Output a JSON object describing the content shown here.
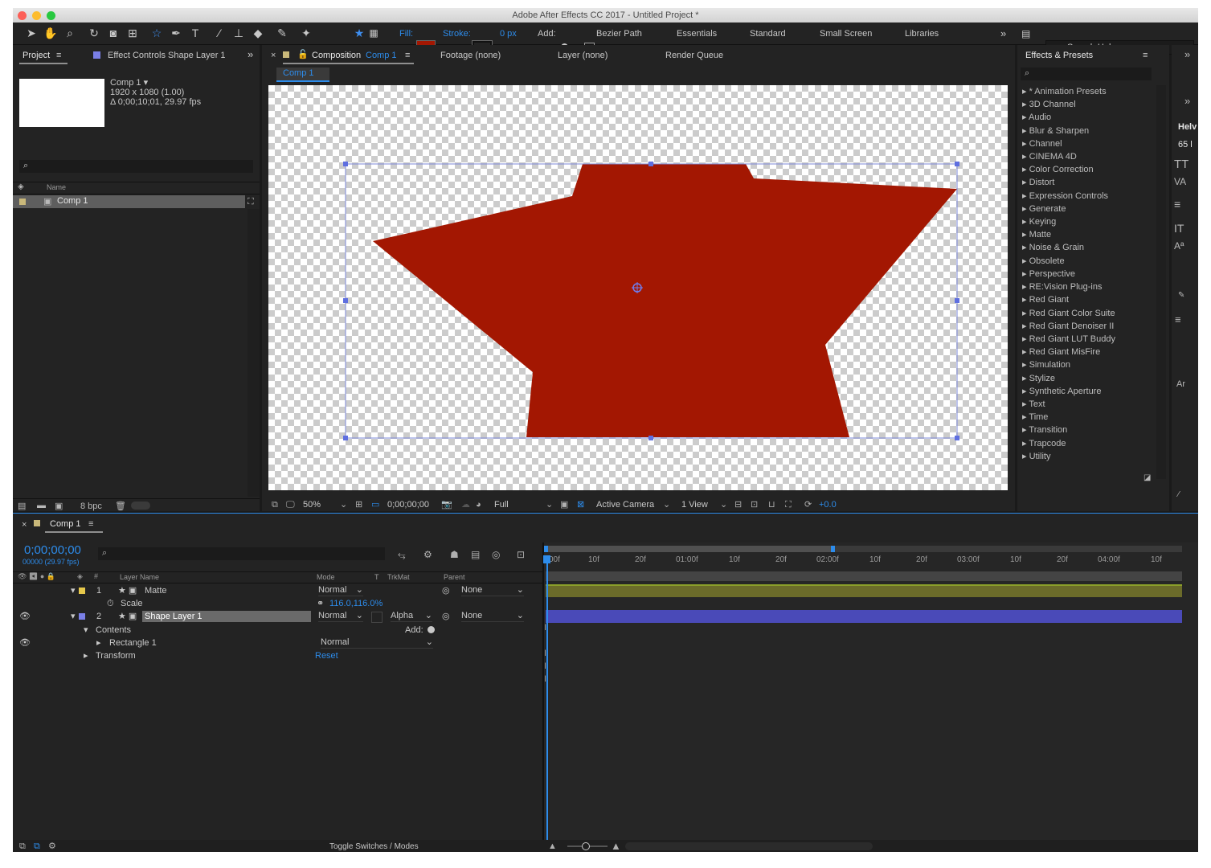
{
  "window": {
    "title": "Adobe After Effects CC 2017 - Untitled Project *"
  },
  "toolbar": {
    "fill_label": "Fill:",
    "stroke_label": "Stroke:",
    "stroke_width": "0 px",
    "add_label": "Add:",
    "bezier_label": "Bezier Path",
    "workspaces": [
      "Essentials",
      "Standard",
      "Small Screen",
      "Libraries"
    ],
    "search_placeholder": "Search Help",
    "fill_color": "#a31702"
  },
  "project_panel": {
    "tab_label": "Project",
    "effect_controls_tab": "Effect Controls Shape Layer 1",
    "comp_name": "Comp 1 ▾",
    "comp_size": "1920 x 1080 (1.00)",
    "comp_duration": "Δ 0;00;10;01, 29.97 fps",
    "column_name": "Name",
    "items": [
      {
        "name": "Comp 1"
      }
    ],
    "bpc": "8 bpc"
  },
  "composition_panel": {
    "tab_prefix": "Composition",
    "tab_name": "Comp 1",
    "footage_tab": "Footage (none)",
    "layer_tab": "Layer (none)",
    "render_tab": "Render Queue",
    "comp_button": "Comp 1",
    "zoom": "50%",
    "timecode": "0;00;00;00",
    "resolution": "Full",
    "camera": "Active Camera",
    "views": "1 View",
    "exposure": "+0.0",
    "shape_color": "#a31702"
  },
  "effects_panel": {
    "title": "Effects & Presets",
    "items": [
      "* Animation Presets",
      "3D Channel",
      "Audio",
      "Blur & Sharpen",
      "Channel",
      "CINEMA 4D",
      "Color Correction",
      "Distort",
      "Expression Controls",
      "Generate",
      "Keying",
      "Matte",
      "Noise & Grain",
      "Obsolete",
      "Perspective",
      "RE:Vision Plug-ins",
      "Red Giant",
      "Red Giant Color Suite",
      "Red Giant Denoiser II",
      "Red Giant LUT Buddy",
      "Red Giant MisFire",
      "Simulation",
      "Stylize",
      "Synthetic Aperture",
      "Text",
      "Time",
      "Transition",
      "Trapcode",
      "Utility"
    ]
  },
  "side_panel": {
    "font": "Helv",
    "size": "65 l",
    "ar": "Ar"
  },
  "timeline": {
    "tab_label": "Comp 1",
    "timecode": "0;00;00;00",
    "frame_info": "00000 (29.97 fps)",
    "headers": {
      "layer_name": "Layer Name",
      "mode": "Mode",
      "t": "T",
      "trkmat": "TrkMat",
      "parent": "Parent"
    },
    "layers": [
      {
        "num": "1",
        "name": "Matte",
        "mode": "Normal",
        "trkmat": "",
        "parent": "None",
        "color": "#e6c84b"
      },
      {
        "num": "2",
        "name": "Shape Layer 1",
        "mode": "Normal",
        "trkmat": "Alpha",
        "parent": "None",
        "color": "#7a7fe6"
      }
    ],
    "scale_label": "Scale",
    "scale_value": "116.0,116.0%",
    "contents_label": "Contents",
    "add_label": "Add:",
    "rectangle_label": "Rectangle 1",
    "rectangle_mode": "Normal",
    "transform_label": "Transform",
    "reset_label": "Reset",
    "ruler_ticks": [
      "00f",
      "10f",
      "20f",
      "01:00f",
      "10f",
      "20f",
      "02:00f",
      "10f",
      "20f",
      "03:00f",
      "10f",
      "20f",
      "04:00f",
      "10f"
    ],
    "toggle_label": "Toggle Switches / Modes"
  }
}
